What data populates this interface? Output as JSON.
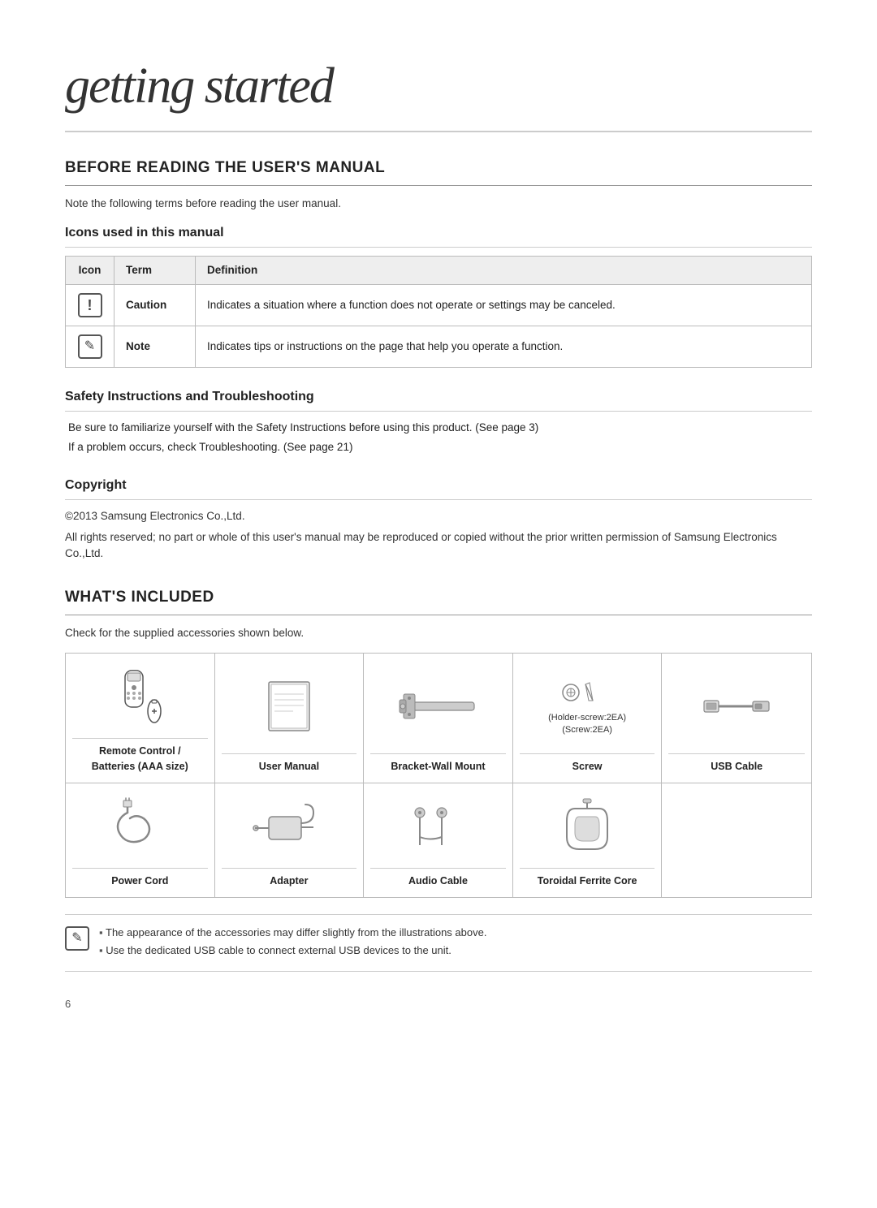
{
  "page": {
    "title": "getting started",
    "page_number": "6"
  },
  "before_reading": {
    "heading": "BEFORE READING THE USER'S MANUAL",
    "intro": "Note the following terms before reading the user manual.",
    "icons_section": {
      "heading": "Icons used in this manual",
      "table": {
        "col_icon": "Icon",
        "col_term": "Term",
        "col_definition": "Definition",
        "rows": [
          {
            "term": "Caution",
            "definition": "Indicates a situation where a function does not operate or settings may be canceled."
          },
          {
            "term": "Note",
            "definition": "Indicates tips or instructions on the page that help you operate a function."
          }
        ]
      }
    },
    "safety_section": {
      "heading": "Safety Instructions and Troubleshooting",
      "items": [
        "Be sure to familiarize yourself with the Safety Instructions before using this product. (See page 3)",
        "If a problem occurs, check Troubleshooting. (See page 21)"
      ]
    },
    "copyright_section": {
      "heading": "Copyright",
      "lines": [
        "©2013 Samsung Electronics Co.,Ltd.",
        "All rights reserved; no part or whole of this user's manual may be reproduced or copied without the prior written permission of Samsung Electronics Co.,Ltd."
      ]
    }
  },
  "whats_included": {
    "heading": "WHAT'S INCLUDED",
    "intro": "Check for the supplied accessories shown below.",
    "accessories": [
      {
        "label": "Remote Control /\nBatteries (AAA size)",
        "type": "remote"
      },
      {
        "label": "User Manual",
        "type": "manual"
      },
      {
        "label": "Bracket-Wall Mount",
        "type": "bracket"
      },
      {
        "label": "Screw",
        "type": "screw",
        "extra": "(Holder-screw:2EA)\n(Screw:2EA)"
      },
      {
        "label": "USB Cable",
        "type": "usb"
      },
      {
        "label": "Power Cord",
        "type": "powercord"
      },
      {
        "label": "Adapter",
        "type": "adapter"
      },
      {
        "label": "Audio Cable",
        "type": "audiocable"
      },
      {
        "label": "Toroidal Ferrite Core",
        "type": "ferrite"
      }
    ],
    "notes": [
      "The appearance of the accessories may differ slightly from the illustrations above.",
      "Use the dedicated USB cable to connect external USB devices to the unit."
    ]
  }
}
